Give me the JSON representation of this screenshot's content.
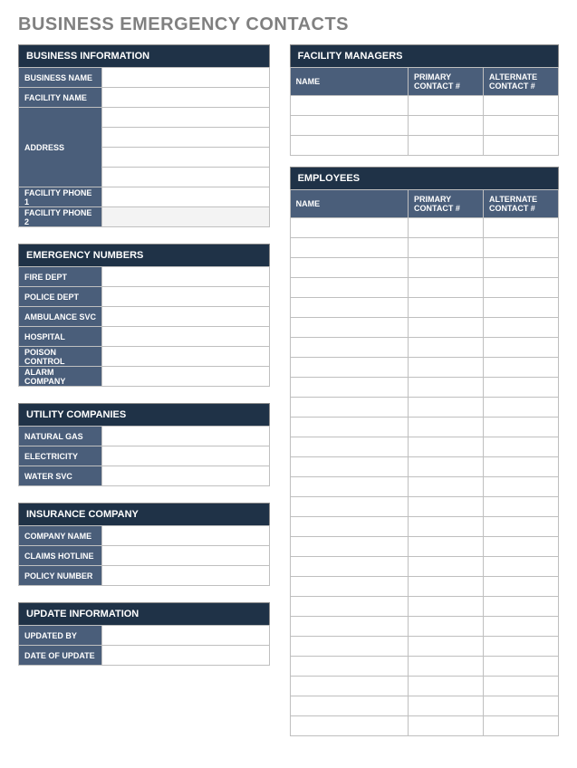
{
  "page_title": "BUSINESS EMERGENCY CONTACTS",
  "business_info": {
    "title": "BUSINESS INFORMATION",
    "fields": {
      "business_name": {
        "label": "BUSINESS NAME",
        "value": ""
      },
      "facility_name": {
        "label": "FACILITY NAME",
        "value": ""
      },
      "address": {
        "label": "ADDRESS",
        "value": ""
      },
      "phone1": {
        "label": "FACILITY PHONE 1",
        "value": ""
      },
      "phone2": {
        "label": "FACILITY PHONE 2",
        "value": ""
      }
    }
  },
  "emergency": {
    "title": "EMERGENCY NUMBERS",
    "fields": {
      "fire": {
        "label": "FIRE DEPT",
        "value": ""
      },
      "police": {
        "label": "POLICE DEPT",
        "value": ""
      },
      "ambulance": {
        "label": "AMBULANCE SVC",
        "value": ""
      },
      "hospital": {
        "label": "HOSPITAL",
        "value": ""
      },
      "poison": {
        "label": "POISON CONTROL",
        "value": ""
      },
      "alarm": {
        "label": "ALARM COMPANY",
        "value": ""
      }
    }
  },
  "utility": {
    "title": "UTILITY COMPANIES",
    "fields": {
      "gas": {
        "label": "NATURAL GAS",
        "value": ""
      },
      "elec": {
        "label": "ELECTRICITY",
        "value": ""
      },
      "water": {
        "label": "WATER SVC",
        "value": ""
      }
    }
  },
  "insurance": {
    "title": "INSURANCE COMPANY",
    "fields": {
      "company": {
        "label": "COMPANY NAME",
        "value": ""
      },
      "claims": {
        "label": "CLAIMS HOTLINE",
        "value": ""
      },
      "policy": {
        "label": "POLICY NUMBER",
        "value": ""
      }
    }
  },
  "update": {
    "title": "UPDATE INFORMATION",
    "fields": {
      "by": {
        "label": "UPDATED BY",
        "value": ""
      },
      "date": {
        "label": "DATE OF UPDATE",
        "value": ""
      }
    }
  },
  "facility_managers": {
    "title": "FACILITY MANAGERS",
    "columns": {
      "name": "NAME",
      "primary": "PRIMARY CONTACT #",
      "alternate": "ALTERNATE CONTACT #"
    },
    "rows": [
      {
        "name": "",
        "primary": "",
        "alternate": ""
      },
      {
        "name": "",
        "primary": "",
        "alternate": ""
      },
      {
        "name": "",
        "primary": "",
        "alternate": ""
      }
    ]
  },
  "employees": {
    "title": "EMPLOYEES",
    "columns": {
      "name": "NAME",
      "primary": "PRIMARY CONTACT #",
      "alternate": "ALTERNATE CONTACT #"
    },
    "rows": [
      {
        "name": "",
        "primary": "",
        "alternate": ""
      },
      {
        "name": "",
        "primary": "",
        "alternate": ""
      },
      {
        "name": "",
        "primary": "",
        "alternate": ""
      },
      {
        "name": "",
        "primary": "",
        "alternate": ""
      },
      {
        "name": "",
        "primary": "",
        "alternate": ""
      },
      {
        "name": "",
        "primary": "",
        "alternate": ""
      },
      {
        "name": "",
        "primary": "",
        "alternate": ""
      },
      {
        "name": "",
        "primary": "",
        "alternate": ""
      },
      {
        "name": "",
        "primary": "",
        "alternate": ""
      },
      {
        "name": "",
        "primary": "",
        "alternate": ""
      },
      {
        "name": "",
        "primary": "",
        "alternate": ""
      },
      {
        "name": "",
        "primary": "",
        "alternate": ""
      },
      {
        "name": "",
        "primary": "",
        "alternate": ""
      },
      {
        "name": "",
        "primary": "",
        "alternate": ""
      },
      {
        "name": "",
        "primary": "",
        "alternate": ""
      },
      {
        "name": "",
        "primary": "",
        "alternate": ""
      },
      {
        "name": "",
        "primary": "",
        "alternate": ""
      },
      {
        "name": "",
        "primary": "",
        "alternate": ""
      },
      {
        "name": "",
        "primary": "",
        "alternate": ""
      },
      {
        "name": "",
        "primary": "",
        "alternate": ""
      },
      {
        "name": "",
        "primary": "",
        "alternate": ""
      },
      {
        "name": "",
        "primary": "",
        "alternate": ""
      },
      {
        "name": "",
        "primary": "",
        "alternate": ""
      },
      {
        "name": "",
        "primary": "",
        "alternate": ""
      },
      {
        "name": "",
        "primary": "",
        "alternate": ""
      },
      {
        "name": "",
        "primary": "",
        "alternate": ""
      }
    ]
  }
}
